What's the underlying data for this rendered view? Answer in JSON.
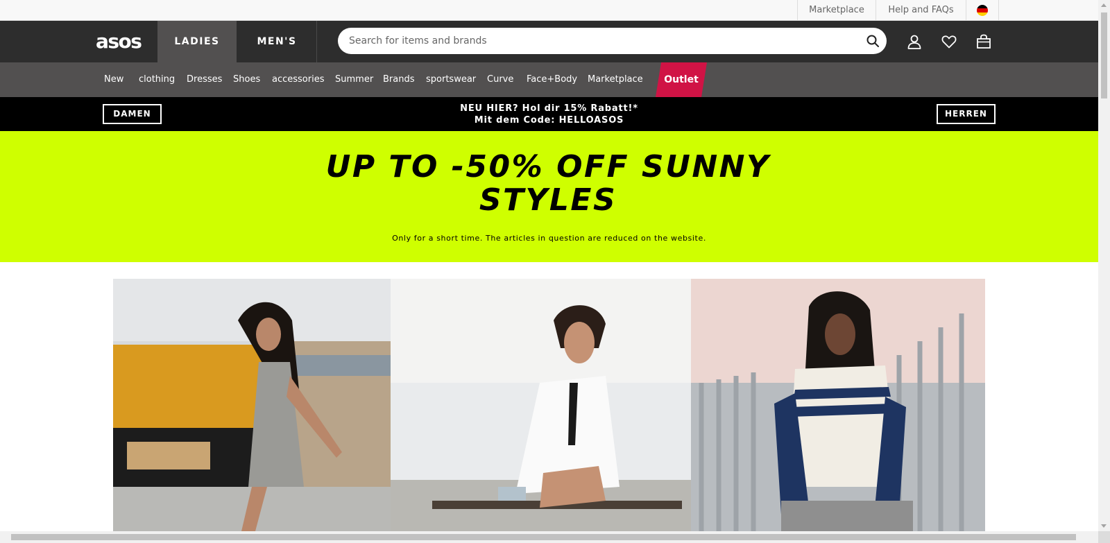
{
  "utility_bar": {
    "links": [
      "Marketplace",
      "Help and FAQs"
    ],
    "country_flag": "germany-flag"
  },
  "header": {
    "logo": "asos",
    "tabs": [
      {
        "label": "LADIES",
        "active": true
      },
      {
        "label": "MEN'S",
        "active": false
      }
    ],
    "search": {
      "placeholder": "Search for items and brands",
      "value": ""
    },
    "icons": [
      "search-icon",
      "account-icon",
      "heart-icon",
      "bag-icon"
    ]
  },
  "category_nav": {
    "items": [
      "New",
      "clothing",
      "Dresses",
      "Shoes",
      "accessories",
      "Summer",
      "Brands",
      "sportswear",
      "Curve",
      "Face+Body",
      "Marketplace"
    ],
    "outlet_label": "Outlet"
  },
  "promo_strip": {
    "left_button": "DAMEN",
    "right_button": "HERREN",
    "line1": "NEU HIER? Hol dir 15% Rabatt!*",
    "line2": "Mit dem Code: HELLOASOS"
  },
  "banner": {
    "headline_line1": "UP TO -50% OFF SUNNY",
    "headline_line2": "STYLES",
    "subtext": "Only for a short time. The articles in question are reduced on the website."
  },
  "image_tiles": [
    {
      "name": "model-plaid-dress"
    },
    {
      "name": "model-white-shirt"
    },
    {
      "name": "model-striped-knit"
    }
  ],
  "colors": {
    "header_bg": "#2d2d2d",
    "nav_bg": "#525050",
    "outlet_accent": "#d01345",
    "banner_bg": "#cfff00",
    "promo_bg": "#000000"
  }
}
